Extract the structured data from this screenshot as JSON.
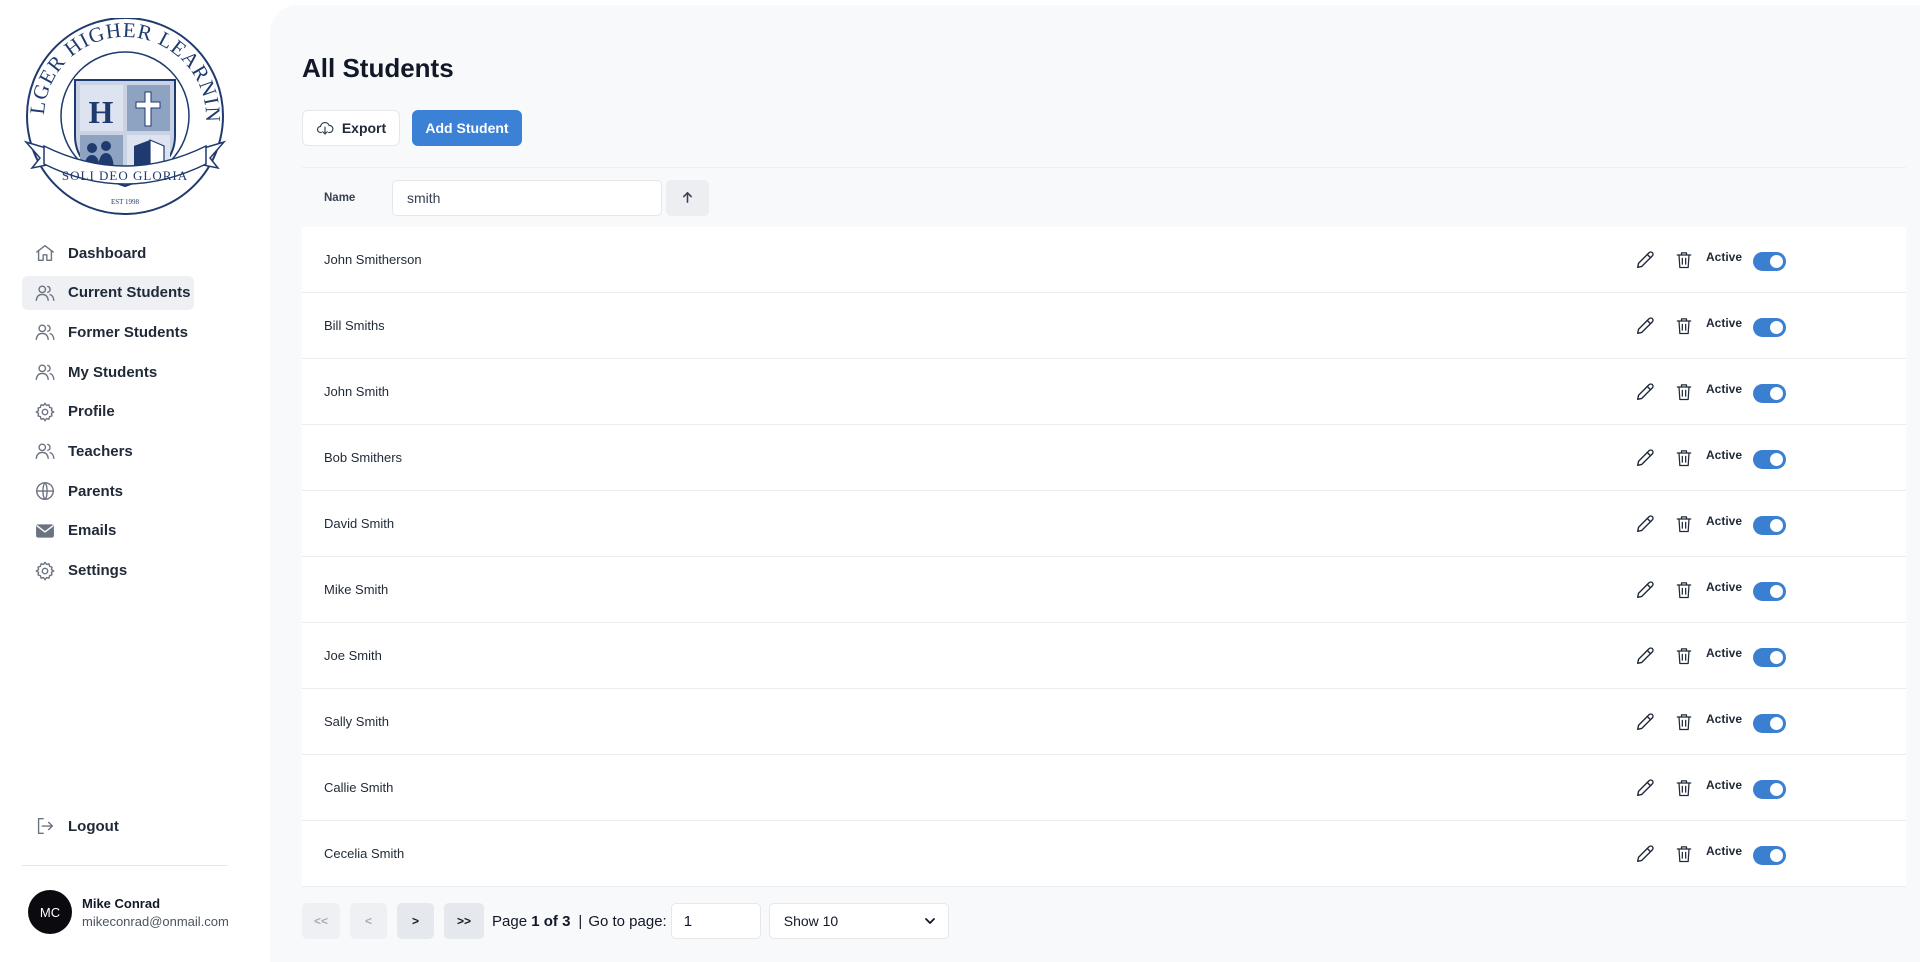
{
  "school": {
    "logo_name": "HILGER HIGHER LEARNING",
    "motto": "SOLI DEO GLORIA",
    "est": "EST 1998"
  },
  "sidebar": {
    "items": [
      {
        "label": "Dashboard",
        "icon": "home-icon",
        "active": false
      },
      {
        "label": "Current Students",
        "icon": "users-icon",
        "active": true
      },
      {
        "label": "Former Students",
        "icon": "users-icon",
        "active": false
      },
      {
        "label": "My Students",
        "icon": "users-icon",
        "active": false
      },
      {
        "label": "Profile",
        "icon": "gear-icon",
        "active": false
      },
      {
        "label": "Teachers",
        "icon": "users-icon",
        "active": false
      },
      {
        "label": "Parents",
        "icon": "globe-icon",
        "active": false
      },
      {
        "label": "Emails",
        "icon": "envelope-icon",
        "active": false
      },
      {
        "label": "Settings",
        "icon": "gear-icon",
        "active": false
      }
    ],
    "logout_label": "Logout",
    "user": {
      "initials": "MC",
      "name": "Mike Conrad",
      "email": "mikeconrad@onmail.com"
    }
  },
  "main": {
    "title": "All Students",
    "export_label": "Export",
    "add_label": "Add Student",
    "table": {
      "column_name": "Name",
      "filter_value": "smith",
      "rows": [
        {
          "name": "John Smitherson",
          "status": "Active",
          "active": true
        },
        {
          "name": "Bill Smiths",
          "status": "Active",
          "active": true
        },
        {
          "name": "John Smith",
          "status": "Active",
          "active": true
        },
        {
          "name": "Bob Smithers",
          "status": "Active",
          "active": true
        },
        {
          "name": "David Smith",
          "status": "Active",
          "active": true
        },
        {
          "name": "Mike Smith",
          "status": "Active",
          "active": true
        },
        {
          "name": "Joe Smith",
          "status": "Active",
          "active": true
        },
        {
          "name": "Sally Smith",
          "status": "Active",
          "active": true
        },
        {
          "name": "Callie Smith",
          "status": "Active",
          "active": true
        },
        {
          "name": "Cecelia Smith",
          "status": "Active",
          "active": true
        }
      ]
    },
    "pagination": {
      "first_label": "<<",
      "prev_label": "<",
      "next_label": ">",
      "last_label": ">>",
      "page_prefix": "Page",
      "page_current": "1",
      "page_of": "of",
      "page_total": "3",
      "separator": "|",
      "goto_label": "Go to page:",
      "goto_value": "1",
      "show_value": "Show 10"
    }
  },
  "colors": {
    "accent": "#3b82d6",
    "toggle_on": "#3b7fd1",
    "main_bg": "#f7f9fb",
    "navy": "#1e3a6e"
  }
}
